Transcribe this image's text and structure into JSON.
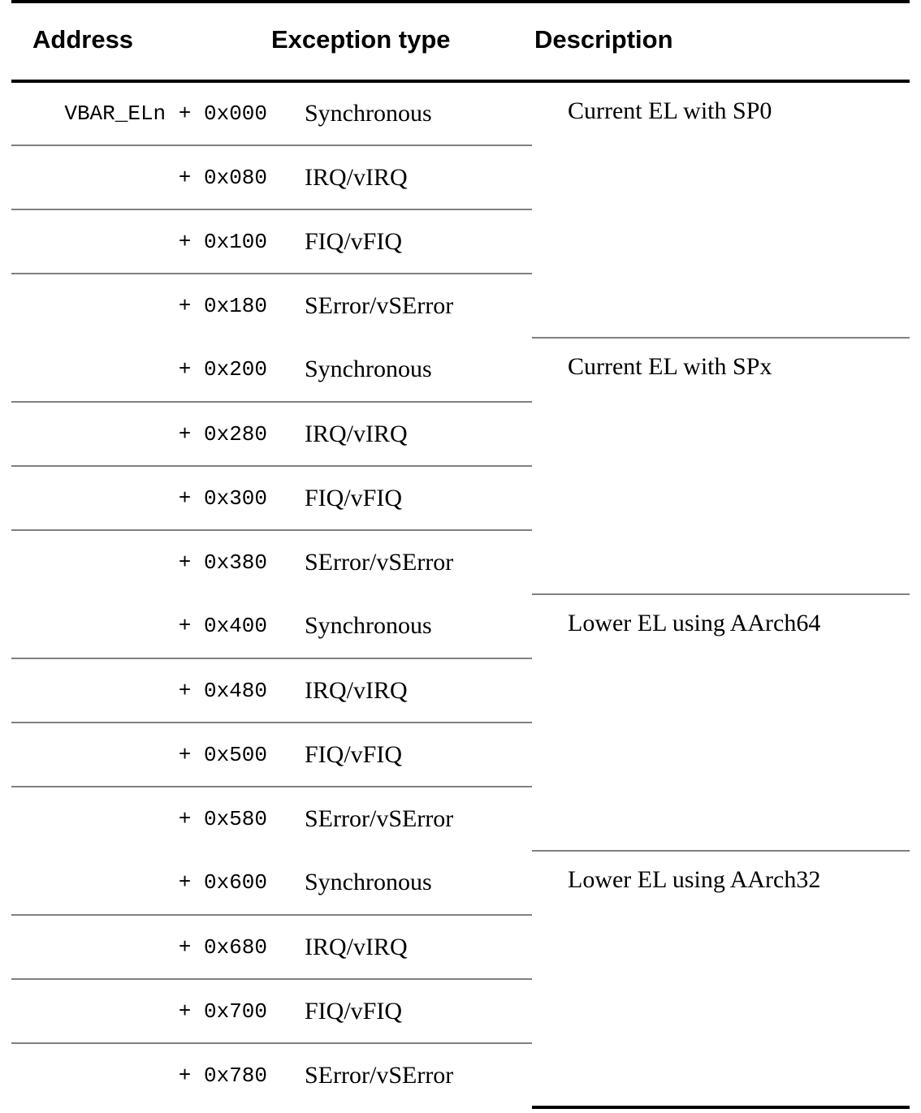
{
  "table": {
    "columns": [
      {
        "key": "address",
        "label": "Address"
      },
      {
        "key": "exception",
        "label": "Exception type"
      },
      {
        "key": "description",
        "label": "Description"
      }
    ],
    "address_base": "VBAR_ELn",
    "groups": [
      {
        "description": "Current EL with SP0",
        "rows": [
          {
            "address_base": "VBAR_ELn",
            "address_offset": "+ 0x000",
            "exception": "Synchronous"
          },
          {
            "address_base": "",
            "address_offset": "+ 0x080",
            "exception": "IRQ/vIRQ"
          },
          {
            "address_base": "",
            "address_offset": "+ 0x100",
            "exception": "FIQ/vFIQ"
          },
          {
            "address_base": "",
            "address_offset": "+ 0x180",
            "exception": "SError/vSError"
          }
        ]
      },
      {
        "description": "Current EL with SPx",
        "rows": [
          {
            "address_base": "",
            "address_offset": "+ 0x200",
            "exception": "Synchronous"
          },
          {
            "address_base": "",
            "address_offset": "+ 0x280",
            "exception": "IRQ/vIRQ"
          },
          {
            "address_base": "",
            "address_offset": "+ 0x300",
            "exception": "FIQ/vFIQ"
          },
          {
            "address_base": "",
            "address_offset": "+ 0x380",
            "exception": "SError/vSError"
          }
        ]
      },
      {
        "description": "Lower EL using AArch64",
        "rows": [
          {
            "address_base": "",
            "address_offset": "+ 0x400",
            "exception": "Synchronous"
          },
          {
            "address_base": "",
            "address_offset": "+ 0x480",
            "exception": "IRQ/vIRQ"
          },
          {
            "address_base": "",
            "address_offset": "+ 0x500",
            "exception": "FIQ/vFIQ"
          },
          {
            "address_base": "",
            "address_offset": "+ 0x580",
            "exception": "SError/vSError"
          }
        ]
      },
      {
        "description": "Lower EL using AArch32",
        "rows": [
          {
            "address_base": "",
            "address_offset": "+ 0x600",
            "exception": "Synchronous"
          },
          {
            "address_base": "",
            "address_offset": "+ 0x680",
            "exception": "IRQ/vIRQ"
          },
          {
            "address_base": "",
            "address_offset": "+ 0x700",
            "exception": "FIQ/vFIQ"
          },
          {
            "address_base": "",
            "address_offset": "+ 0x780",
            "exception": "SError/vSError"
          }
        ]
      }
    ]
  },
  "colors": {
    "text": "#000000",
    "rule_strong": "#000000",
    "rule_light": "#808080",
    "background": "#ffffff"
  }
}
